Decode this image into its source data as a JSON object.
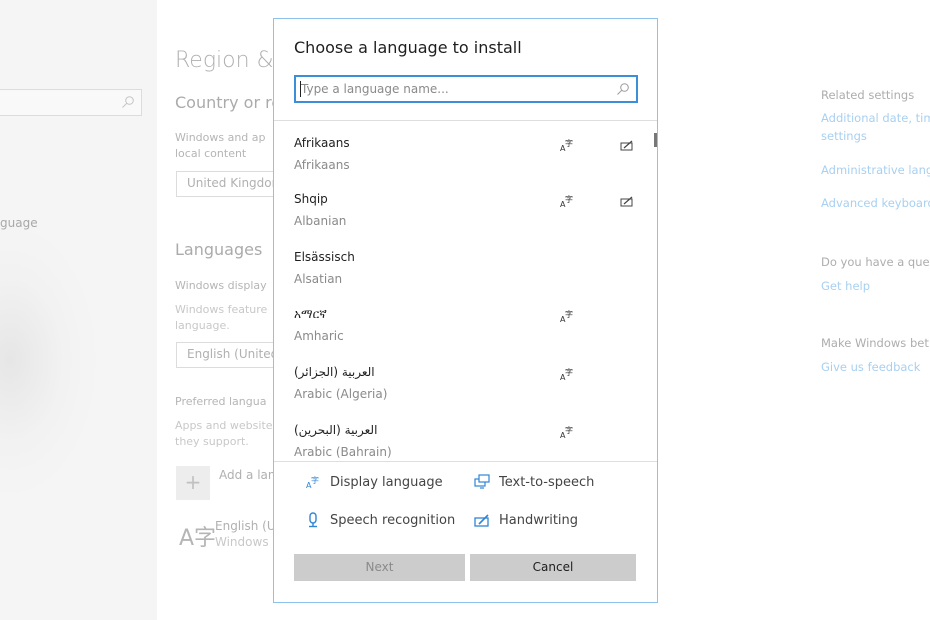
{
  "background": {
    "nav": {
      "search_icon": "search-icon",
      "language_item_partial": "guage"
    },
    "main": {
      "title": "Region &",
      "country_heading": "Country or re",
      "country_desc_line1": "Windows and ap",
      "country_desc_line2": "local content",
      "country_value": "United Kingdon",
      "languages_heading": "Languages",
      "windows_display_label": "Windows display",
      "windows_features_line1": "Windows feature",
      "windows_features_line2": "language.",
      "display_language_value": "English (United",
      "preferred_label": "Preferred langua",
      "preferred_desc_line1": "Apps and website",
      "preferred_desc_line2": "they support.",
      "add_language_label": "Add a lan",
      "add_icon": "+",
      "installed_language": "English (U",
      "installed_language_sub": "Windows",
      "language_glyph": "A字"
    },
    "related": {
      "heading": "Related settings",
      "links": [
        "Additional date, tim",
        "settings",
        "Administrative lang",
        "Advanced keyboard"
      ],
      "question": "Do you have a ques",
      "help_link": "Get help",
      "feedback_heading": "Make Windows bet",
      "feedback_link": "Give us feedback"
    }
  },
  "dialog": {
    "title": "Choose a language to install",
    "search": {
      "value": "",
      "placeholder": "Type a language name..."
    },
    "languages": [
      {
        "native": "Afrikaans",
        "english": "Afrikaans",
        "display_language": true,
        "handwriting": true
      },
      {
        "native": "Shqip",
        "english": "Albanian",
        "display_language": true,
        "handwriting": true
      },
      {
        "native": "Elsässisch",
        "english": "Alsatian",
        "display_language": false,
        "handwriting": false
      },
      {
        "native": "አማርኛ",
        "english": "Amharic",
        "display_language": true,
        "handwriting": false
      },
      {
        "native": "العربية (الجزائر)",
        "english": "Arabic (Algeria)",
        "display_language": true,
        "handwriting": false
      },
      {
        "native": "العربية (البحرين)",
        "english": "Arabic (Bahrain)",
        "display_language": true,
        "handwriting": false
      }
    ],
    "legend": {
      "display_language": "Display language",
      "text_to_speech": "Text-to-speech",
      "speech_recognition": "Speech recognition",
      "handwriting": "Handwriting"
    },
    "buttons": {
      "next": "Next",
      "cancel": "Cancel"
    },
    "colors": {
      "accent": "#3a8fd8",
      "border": "#8dc2ec",
      "icon_blue": "#2f86d6"
    }
  }
}
